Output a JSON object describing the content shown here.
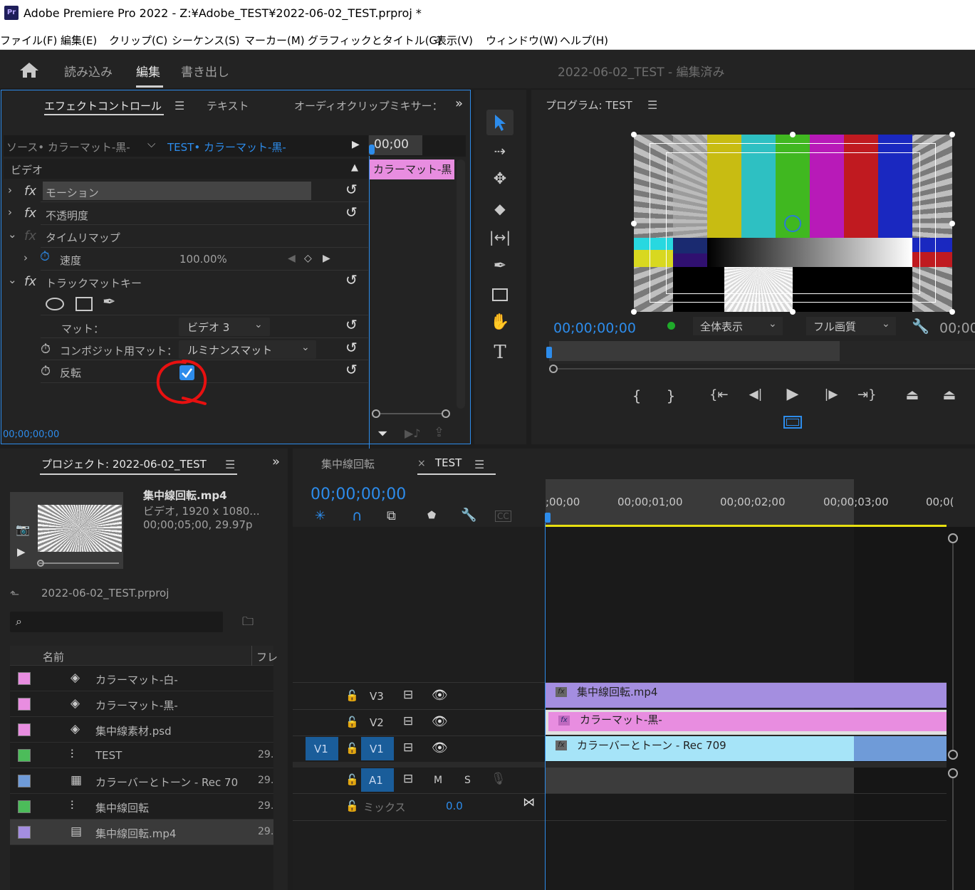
{
  "window": {
    "title": "Adobe Premiere Pro 2022 - Z:¥Adobe_TEST¥2022-06-02_TEST.prproj *",
    "logo": "Pr"
  },
  "menu": [
    "ファイル(F)",
    "編集(E)",
    "クリップ(C)",
    "シーケンス(S)",
    "マーカー(M)",
    "グラフィックとタイトル(G)",
    "表示(V)",
    "ウィンドウ(W)",
    "ヘルプ(H)"
  ],
  "header": {
    "tabs": [
      "読み込み",
      "編集",
      "書き出し"
    ],
    "active_tab": "編集",
    "project_status": "2022-06-02_TEST - 編集済み"
  },
  "effect_controls": {
    "tabs": [
      "エフェクトコントロール",
      "テキスト",
      "オーディオクリップミキサー："
    ],
    "source_label": "ソース• カラーマット-黒-",
    "sequence_label": "TEST• カラーマット-黒-",
    "mini_timecode": "00;00",
    "mini_clip": "カラーマット-黒",
    "section": "ビデオ",
    "effects": {
      "motion": "モーション",
      "opacity": "不透明度",
      "time_remap": "タイムリマップ",
      "speed_label": "速度",
      "speed_value": "100.00%",
      "track_matte": "トラックマットキー",
      "matte_label": "マット：",
      "matte_value": "ビデオ 3",
      "composite_label": "コンポジット用マット：",
      "composite_value": "ルミナンスマット",
      "invert_label": "反転",
      "invert_checked": true
    },
    "footer_timecode": "00;00;00;00"
  },
  "program": {
    "title": "プログラム: TEST",
    "timecode": "00;00;00;00",
    "fit": "全体表示",
    "quality": "フル画質",
    "right_timecode": "00;00"
  },
  "project": {
    "title": "プロジェクト: 2022-06-02_TEST",
    "preview": {
      "name": "集中線回転.mp4",
      "info1": "ビデオ, 1920 x 1080...",
      "info2": "00;00;05;00, 29.97p"
    },
    "file": "2022-06-02_TEST.prproj",
    "search_placeholder": "",
    "columns": [
      "名前",
      "フレ"
    ],
    "items": [
      {
        "name": "カラーマット-白-",
        "color": "#e88de0",
        "fps": ""
      },
      {
        "name": "カラーマット-黒-",
        "color": "#e88de0",
        "fps": ""
      },
      {
        "name": "集中線素材.psd",
        "color": "#e88de0",
        "fps": ""
      },
      {
        "name": "TEST",
        "color": "#4cbc5a",
        "fps": "29."
      },
      {
        "name": "カラーバーとトーン - Rec 70",
        "color": "#6f9bd8",
        "fps": "29."
      },
      {
        "name": "集中線回転",
        "color": "#4cbc5a",
        "fps": "29."
      },
      {
        "name": "集中線回転.mp4",
        "color": "#a48ee0",
        "fps": "29."
      }
    ]
  },
  "timeline": {
    "tabs": [
      "集中線回転",
      "TEST"
    ],
    "close": "×",
    "timecode": "00;00;00;00",
    "ruler": [
      ";00;00",
      "00;00;01;00",
      "00;00;02;00",
      "00;00;03;00",
      "00;0("
    ],
    "tracks": {
      "v3": "V3",
      "v2": "V2",
      "v1": "V1",
      "v1_src": "V1",
      "a1": "A1",
      "m": "M",
      "s": "S",
      "mix_label": "ミックス",
      "mix_value": "0.0"
    },
    "clips": {
      "v3": "集中線回転.mp4",
      "v2": "カラーマット-黒-",
      "v1": "カラーバーとトーン - Rec 709"
    },
    "clip_colors": {
      "v3": "#a48ee0",
      "v2": "#e88de0",
      "v1": "#a6e4f8",
      "v1_tail": "#6f9bd8"
    }
  },
  "colors": {
    "accent": "#2d8ceb",
    "annotation": "#e81010"
  }
}
